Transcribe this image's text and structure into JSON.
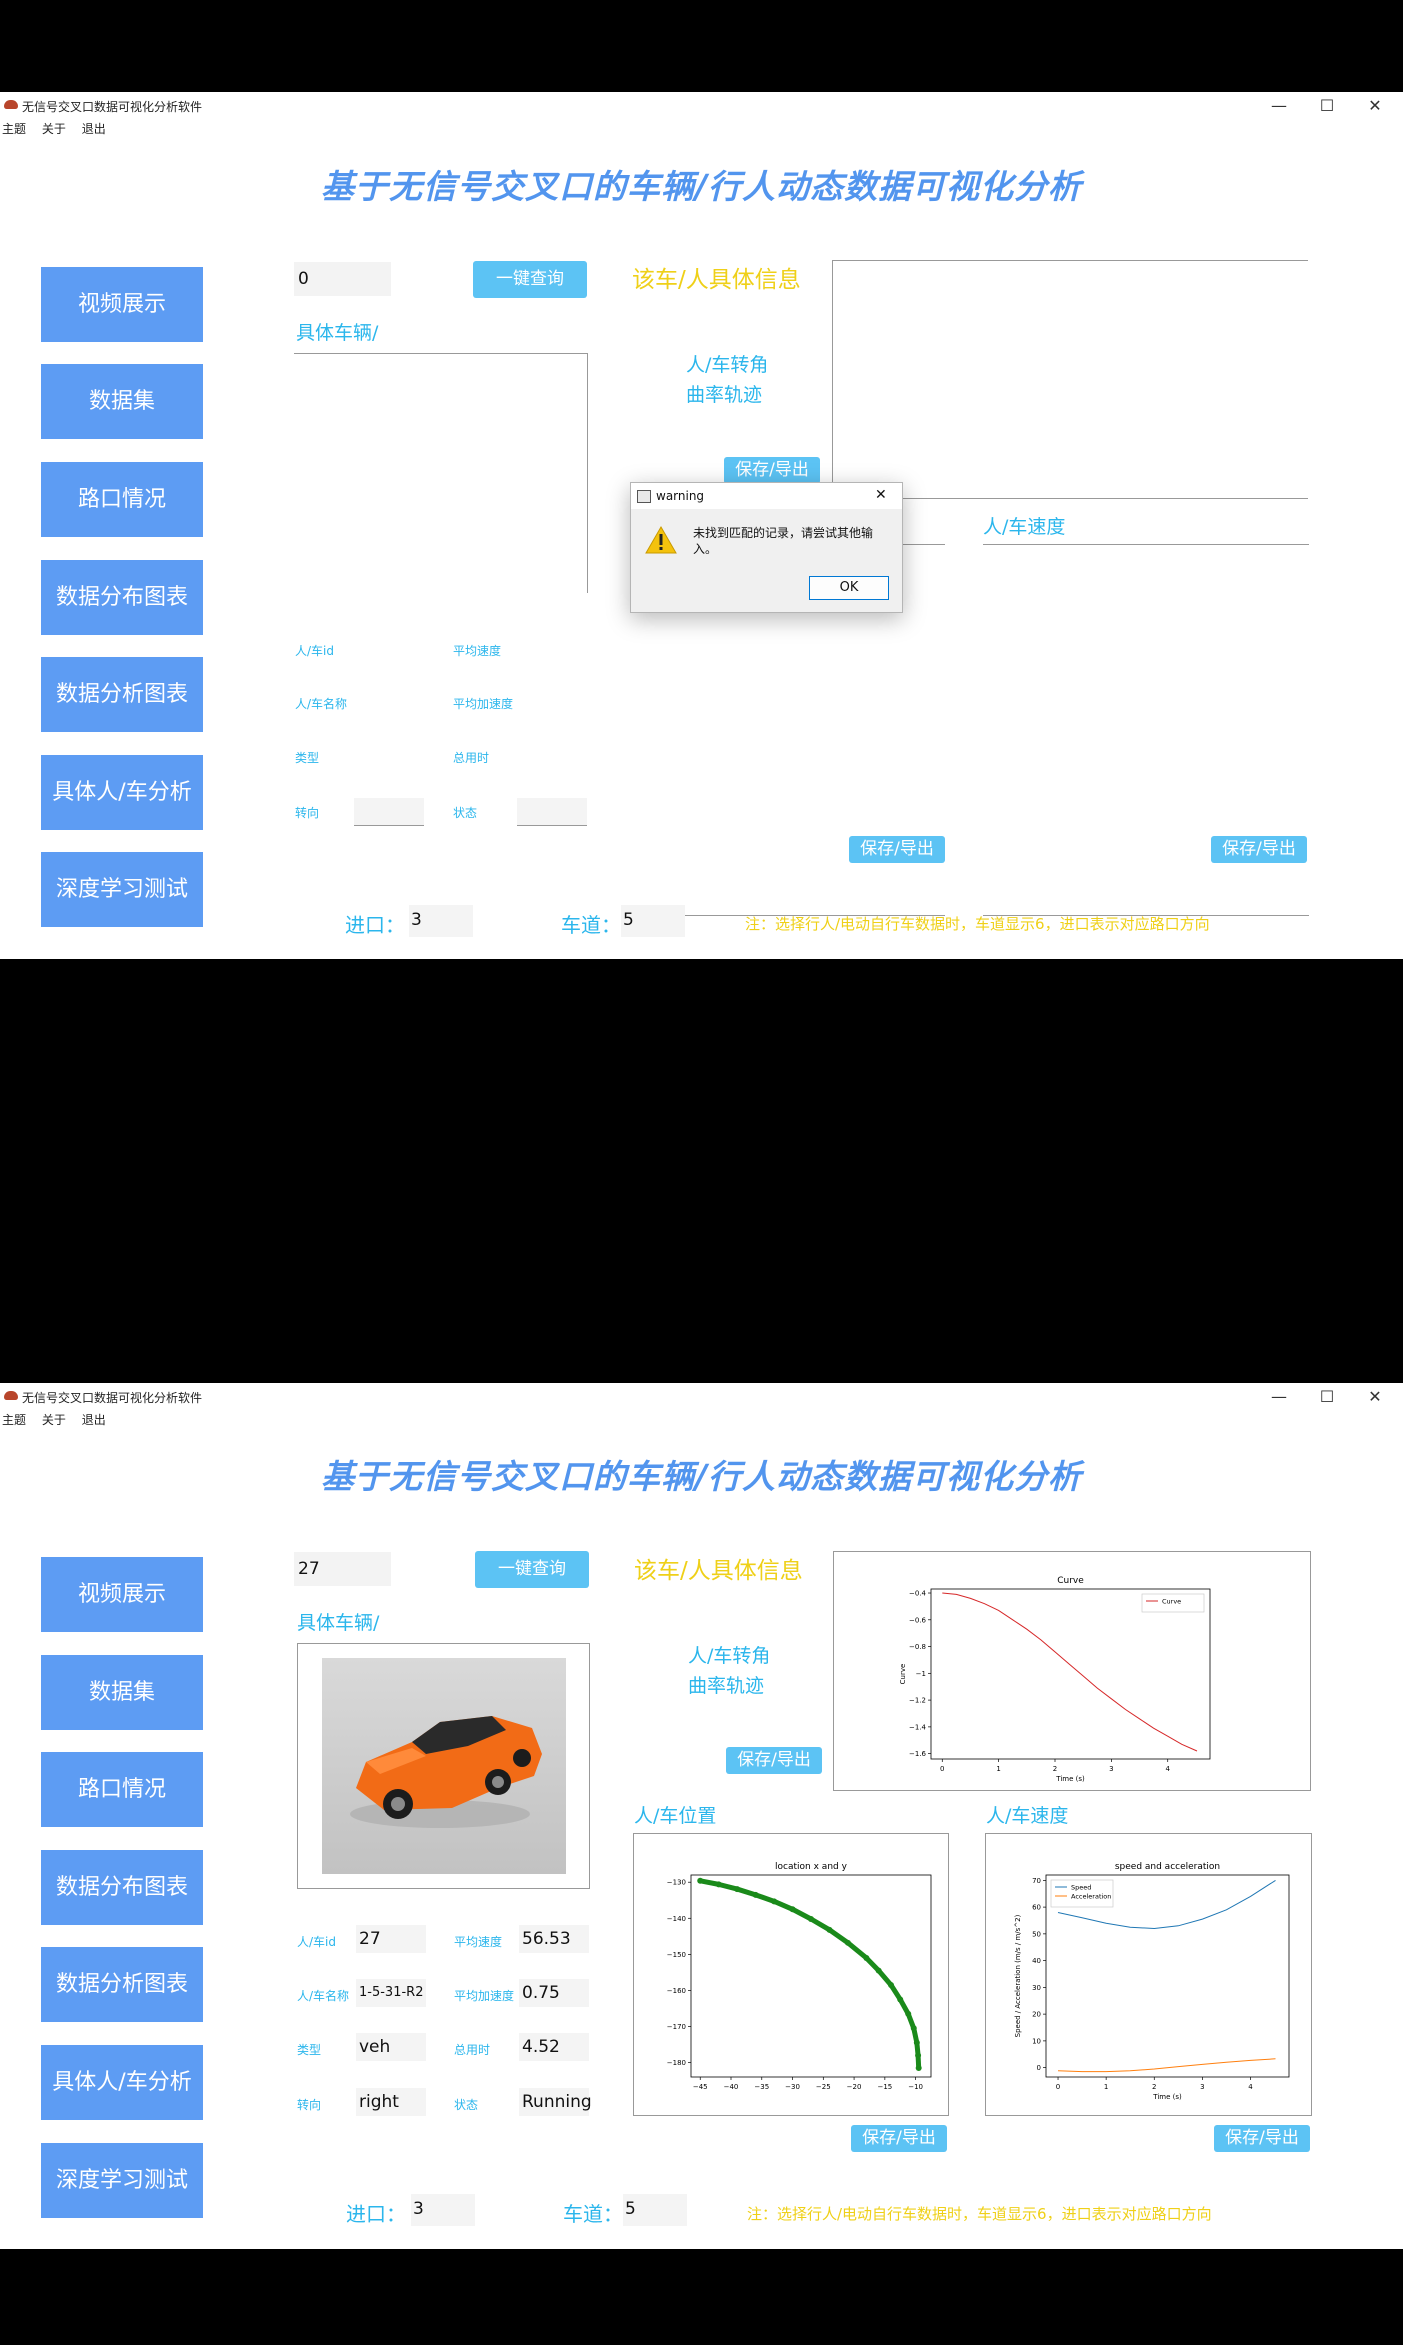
{
  "window": {
    "title": "无信号交叉口数据可视化分析软件",
    "menu": [
      "主题",
      "关于",
      "退出"
    ],
    "controls": {
      "minimize": "—",
      "maximize": "☐",
      "close": "✕"
    }
  },
  "heading": "基于无信号交叉口的车辆/行人动态数据可视化分析",
  "nav": [
    "视频展示",
    "数据集",
    "路口情况",
    "数据分布图表",
    "数据分析图表",
    "具体人/车分析",
    "深度学习测试"
  ],
  "labels": {
    "query_button": "一键查询",
    "specific_vehicle": "具体车辆/",
    "info_title": "该车/人具体信息",
    "turn_curve_line1": "人/车转角",
    "turn_curve_line2": "曲率轨迹",
    "position": "人/车位置",
    "speed": "人/车速度",
    "save_export": "保存/导出",
    "field_id": "人/车id",
    "field_name": "人/车名称",
    "field_type": "类型",
    "field_turn": "转向",
    "field_avg_speed": "平均速度",
    "field_avg_accel": "平均加速度",
    "field_total_time": "总用时",
    "field_state": "状态",
    "entrance": "进口：",
    "lane": "车道：",
    "note": "注：选择行人/电动自行车数据时，车道显示6，进口表示对应路口方向"
  },
  "screen1": {
    "id_input": "0",
    "entrance_value": "3",
    "lane_value": "5",
    "dialog": {
      "title": "warning",
      "message": "未找到匹配的记录，请尝试其他输入。",
      "ok": "OK",
      "close": "✕"
    }
  },
  "screen2": {
    "id_input": "27",
    "info": {
      "id": "27",
      "name": "1-5-31-R2",
      "type": "veh",
      "turn": "right",
      "avg_speed": "56.53",
      "avg_accel": "0.75",
      "total_time": "4.52",
      "state": "Running"
    },
    "entrance_value": "3",
    "lane_value": "5"
  },
  "colors": {
    "nav_bg": "#5d9cf3",
    "button_bg": "#5cc3f4",
    "label_cyan": "#2bb6ec",
    "label_yellow": "#efd018",
    "heading": "#5295ee"
  },
  "icons": {
    "warning": "warning-triangle-icon",
    "app": "car-app-icon"
  },
  "chart_data": [
    {
      "type": "line",
      "title": "Curve",
      "xlabel": "Time (s)",
      "ylabel": "Curve",
      "xlim": [
        -0.2,
        4.75
      ],
      "ylim": [
        -1.64,
        -0.37
      ],
      "xticks": [
        0,
        1,
        2,
        3,
        4
      ],
      "yticks": [
        -0.4,
        -0.6,
        -0.8,
        -1.0,
        -1.2,
        -1.4,
        -1.6
      ],
      "legend": "top-right",
      "series": [
        {
          "name": "Curve",
          "color": "#d62728",
          "x": [
            0,
            0.25,
            0.5,
            0.75,
            1.0,
            1.25,
            1.5,
            1.75,
            2.0,
            2.25,
            2.5,
            2.75,
            3.0,
            3.25,
            3.5,
            3.75,
            4.0,
            4.25,
            4.52
          ],
          "y": [
            -0.4,
            -0.41,
            -0.44,
            -0.48,
            -0.53,
            -0.6,
            -0.67,
            -0.75,
            -0.84,
            -0.93,
            -1.02,
            -1.11,
            -1.19,
            -1.27,
            -1.34,
            -1.41,
            -1.47,
            -1.53,
            -1.58
          ]
        }
      ]
    },
    {
      "type": "scatter",
      "title": "location x and y",
      "xlabel": "",
      "ylabel": "",
      "xlim": [
        -46.5,
        -7.5
      ],
      "ylim": [
        -184,
        -128
      ],
      "xticks": [
        -45,
        -40,
        -35,
        -30,
        -25,
        -20,
        -15,
        -10
      ],
      "yticks": [
        -130,
        -140,
        -150,
        -160,
        -170,
        -180
      ],
      "series": [
        {
          "color": "#1a8a1a",
          "x": [
            -45,
            -42,
            -39,
            -36,
            -33,
            -30,
            -27,
            -24,
            -21,
            -18,
            -16,
            -14,
            -12.5,
            -11.2,
            -10.3,
            -9.8,
            -9.6,
            -9.5
          ],
          "y": [
            -129.6,
            -130.6,
            -131.9,
            -133.5,
            -135.3,
            -137.5,
            -140.2,
            -143.2,
            -146.8,
            -151.0,
            -154.5,
            -158.5,
            -162.5,
            -166.5,
            -170.5,
            -174.5,
            -178.0,
            -181.5
          ]
        }
      ]
    },
    {
      "type": "line",
      "title": "speed and acceleration",
      "xlabel": "Time (s)",
      "ylabel": "Speed / Acceleration (m/s / m/s^2)",
      "xlim": [
        -0.25,
        4.8
      ],
      "ylim": [
        -3.5,
        72
      ],
      "xticks": [
        0,
        1,
        2,
        3,
        4
      ],
      "yticks": [
        0,
        10,
        20,
        30,
        40,
        50,
        60,
        70
      ],
      "legend": "top-left",
      "series": [
        {
          "name": "Speed",
          "color": "#1f77b4",
          "x": [
            0,
            0.5,
            1.0,
            1.5,
            2.0,
            2.5,
            3.0,
            3.5,
            4.0,
            4.52
          ],
          "y": [
            58,
            56,
            54,
            52.5,
            52,
            53,
            55.5,
            59,
            64,
            70
          ]
        },
        {
          "name": "Acceleration",
          "color": "#ff7f0e",
          "x": [
            0,
            0.5,
            1.0,
            1.5,
            2.0,
            2.5,
            3.0,
            3.5,
            4.0,
            4.52
          ],
          "y": [
            -1.2,
            -1.5,
            -1.5,
            -1.2,
            -0.5,
            0.4,
            1.2,
            2.0,
            2.7,
            3.3
          ]
        }
      ]
    }
  ]
}
